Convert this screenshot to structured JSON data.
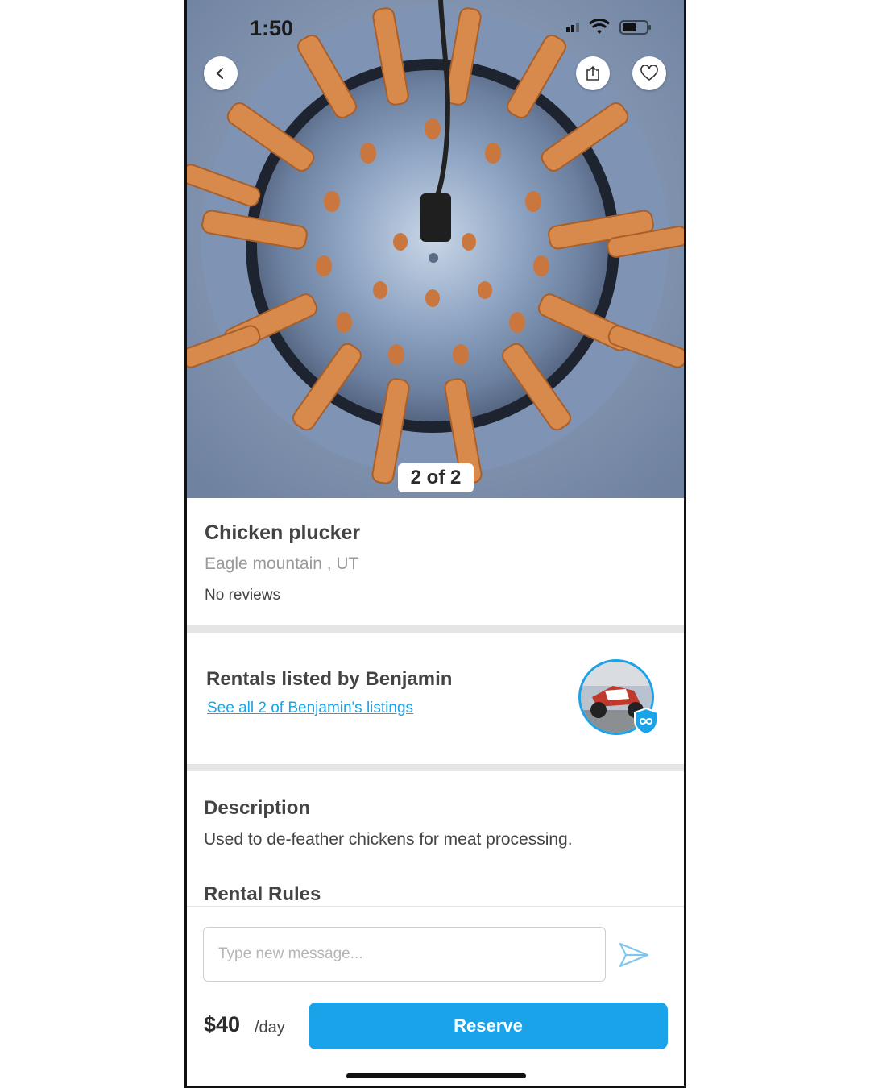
{
  "status_bar": {
    "time": "1:50"
  },
  "gallery": {
    "counter": "2 of 2"
  },
  "listing": {
    "title": "Chicken plucker",
    "location": "Eagle mountain , UT",
    "reviews": "No reviews"
  },
  "owner": {
    "heading": "Rentals listed by Benjamin",
    "link": "See all 2 of Benjamin's listings"
  },
  "description": {
    "heading": "Description",
    "text": "Used to de-feather chickens for meat processing.",
    "rules_heading": "Rental Rules"
  },
  "message": {
    "placeholder": "Type new message..."
  },
  "footer": {
    "price": "$40",
    "unit": "/day",
    "reserve_label": "Reserve"
  },
  "colors": {
    "accent": "#1aa3e8",
    "text": "#444444",
    "muted": "#999999"
  },
  "icons": [
    "back-chevron-icon",
    "share-icon",
    "heart-icon",
    "wifi-icon",
    "signal-icon",
    "battery-icon",
    "verified-infinity-icon",
    "send-icon"
  ]
}
